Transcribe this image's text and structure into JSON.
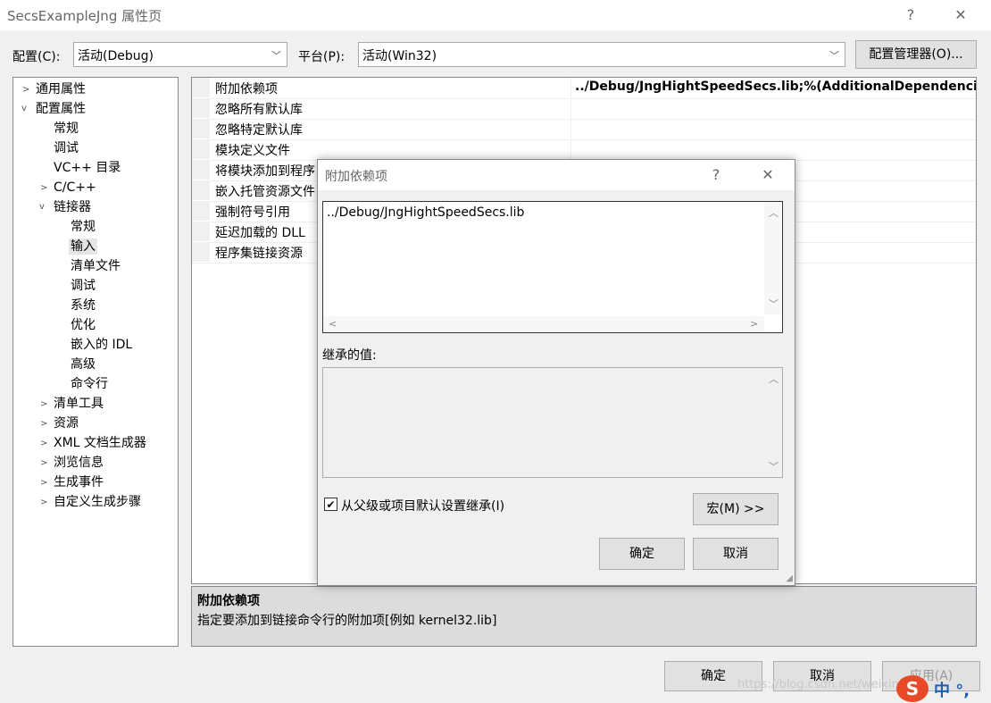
{
  "window": {
    "title": "SecsExampleJng 属性页",
    "help": "?",
    "close": "✕"
  },
  "config": {
    "config_label": "配置(C):",
    "config_value": "活动(Debug)",
    "platform_label": "平台(P):",
    "platform_value": "活动(Win32)",
    "manager_button": "配置管理器(O)..."
  },
  "tree": {
    "common": "通用属性",
    "config_props": "配置属性",
    "general": "常规",
    "debugging": "调试",
    "vcdirs": "VC++ 目录",
    "cpp": "C/C++",
    "linker": "链接器",
    "linker_general": "常规",
    "linker_input": "输入",
    "linker_manifest": "清单文件",
    "linker_debug": "调试",
    "linker_system": "系统",
    "linker_optimize": "优化",
    "linker_idl": "嵌入的 IDL",
    "linker_advanced": "高级",
    "linker_cmdline": "命令行",
    "manifest_tool": "清单工具",
    "resources": "资源",
    "xml_gen": "XML 文档生成器",
    "browse": "浏览信息",
    "build_events": "生成事件",
    "custom_build": "自定义生成步骤"
  },
  "grid": {
    "rows": [
      {
        "name": "附加依赖项",
        "value": "../Debug/JngHightSpeedSecs.lib;%(AdditionalDependencies)"
      },
      {
        "name": "忽略所有默认库",
        "value": ""
      },
      {
        "name": "忽略特定默认库",
        "value": ""
      },
      {
        "name": "模块定义文件",
        "value": ""
      },
      {
        "name": "将模块添加到程序",
        "value": ""
      },
      {
        "name": "嵌入托管资源文件",
        "value": ""
      },
      {
        "name": "强制符号引用",
        "value": ""
      },
      {
        "name": "延迟加载的 DLL",
        "value": ""
      },
      {
        "name": "程序集链接资源",
        "value": ""
      }
    ]
  },
  "description": {
    "title": "附加依赖项",
    "text": "指定要添加到链接命令行的附加项[例如 kernel32.lib]"
  },
  "buttons": {
    "ok": "确定",
    "cancel": "取消",
    "apply": "应用(A)"
  },
  "watermark": "https://blog.csdn.net/weixin_4...",
  "ime": {
    "logo": "S",
    "text": "中 °,"
  },
  "modal": {
    "title": "附加依赖项",
    "help": "?",
    "close": "✕",
    "edit_text": "../Debug/JngHightSpeedSecs.lib",
    "inherited_label": "继承的值:",
    "inherit_checkbox_label": "从父级或项目默认设置继承(I)",
    "inherit_checked": true,
    "macro_button": "宏(M) >>",
    "ok": "确定",
    "cancel": "取消"
  }
}
